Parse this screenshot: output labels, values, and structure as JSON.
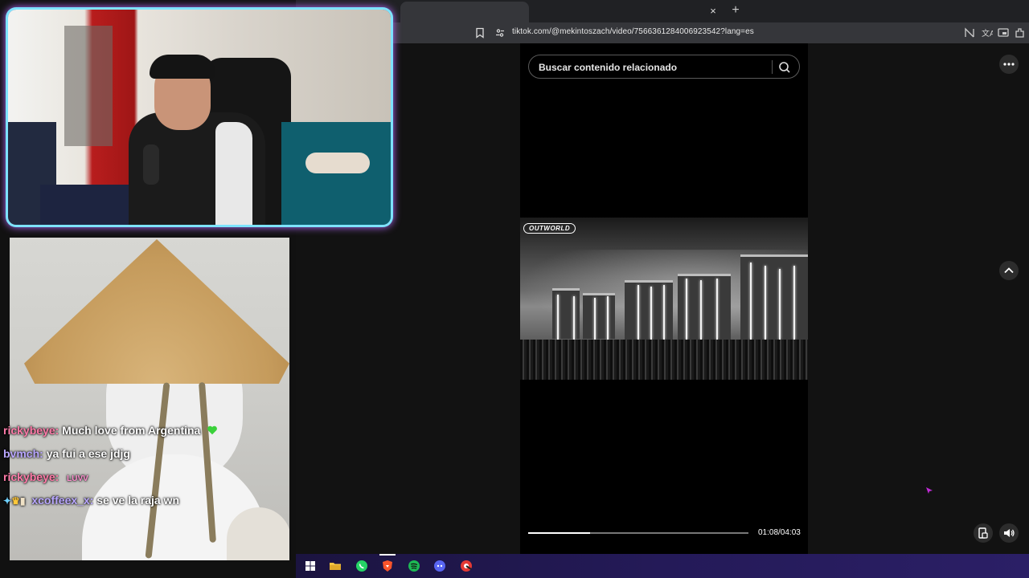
{
  "browser": {
    "tab_close": "×",
    "new_tab": "+",
    "url": "tiktok.com/@mekintoszach/video/7566361284006923542?lang=es"
  },
  "page": {
    "search_placeholder": "Buscar contenido relacionado",
    "video_logo": "OUTWORLD",
    "time": "01:08/04:03",
    "progress": 0.28
  },
  "chat": [
    {
      "user": "rickybeye:",
      "text": "Much love from Argentina",
      "emote": "green-heart"
    },
    {
      "user": "bvmch:",
      "text": "ya fui a ese jdjg"
    },
    {
      "user": "rickybeye:",
      "text": "",
      "emote": "luvv"
    },
    {
      "user": "xcoffeex_x:",
      "text": "se ve la raja wn",
      "badges": [
        "sword",
        "crown",
        "bottle"
      ]
    }
  ],
  "emote_text": "LUVV",
  "taskbar": {
    "apps": [
      "windows-start",
      "file-explorer",
      "whatsapp",
      "brave",
      "spotify",
      "discord",
      "chrome-alt"
    ]
  },
  "colors": {
    "accent_glow": "#7de3ff",
    "chat_user_pink": "#ff7aa8",
    "chat_user_purple": "#b9a7ff",
    "brave": "#fb542b",
    "spotify": "#1db954",
    "discord": "#5865f2",
    "whatsapp": "#25d366"
  }
}
